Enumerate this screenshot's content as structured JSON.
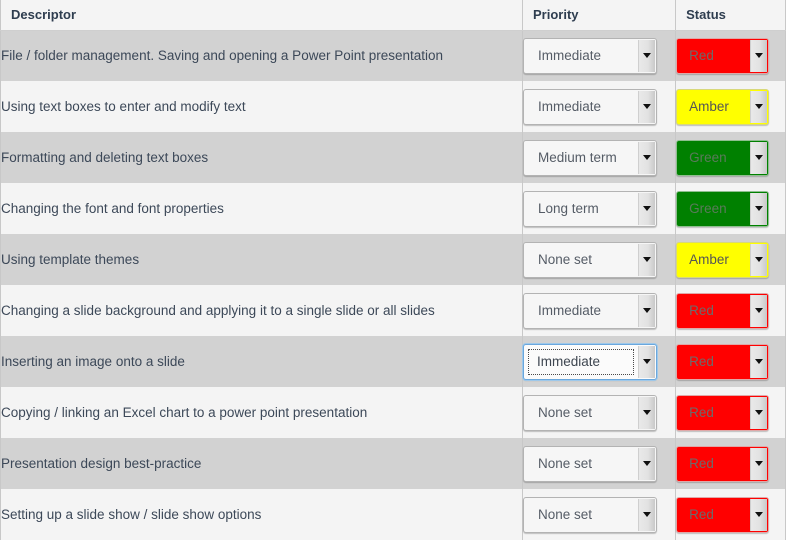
{
  "table": {
    "columns": [
      {
        "key": "descriptor",
        "label": "Descriptor"
      },
      {
        "key": "priority",
        "label": "Priority"
      },
      {
        "key": "status",
        "label": "Status"
      }
    ],
    "rows": [
      {
        "descriptor": "File / folder management. Saving and opening a Power Point presentation",
        "priority": "Immediate",
        "status": "Red",
        "status_color": "#ff0000",
        "stripe": "even",
        "focused": false
      },
      {
        "descriptor": "Using text boxes to enter and modify text",
        "priority": "Immediate",
        "status": "Amber",
        "status_color": "#ffff00",
        "stripe": "odd",
        "focused": false
      },
      {
        "descriptor": "Formatting and deleting text boxes",
        "priority": "Medium term",
        "status": "Green",
        "status_color": "#008000",
        "stripe": "even",
        "focused": false
      },
      {
        "descriptor": "Changing the font and font properties",
        "priority": "Long term",
        "status": "Green",
        "status_color": "#008000",
        "stripe": "odd",
        "focused": false
      },
      {
        "descriptor": "Using template themes",
        "priority": "None set",
        "status": "Amber",
        "status_color": "#ffff00",
        "stripe": "even",
        "focused": false
      },
      {
        "descriptor": "Changing a slide background and applying it to a single slide or all slides",
        "priority": "Immediate",
        "status": "Red",
        "status_color": "#ff0000",
        "stripe": "odd",
        "focused": false
      },
      {
        "descriptor": "Inserting an image onto a slide",
        "priority": "Immediate",
        "status": "Red",
        "status_color": "#ff0000",
        "stripe": "even",
        "focused": true
      },
      {
        "descriptor": "Copying / linking an Excel chart to a power point presentation",
        "priority": "None set",
        "status": "Red",
        "status_color": "#ff0000",
        "stripe": "odd",
        "focused": false
      },
      {
        "descriptor": "Presentation design best-practice",
        "priority": "None set",
        "status": "Red",
        "status_color": "#ff0000",
        "stripe": "even",
        "focused": false
      },
      {
        "descriptor": "Setting up a slide show / slide show options",
        "priority": "None set",
        "status": "Red",
        "status_color": "#ff0000",
        "stripe": "odd",
        "focused": false
      }
    ],
    "priority_options": [
      "None set",
      "Immediate",
      "Medium term",
      "Long term"
    ],
    "status_options": [
      "Red",
      "Amber",
      "Green"
    ],
    "icons": {
      "dropdown": "chevron-down-icon"
    }
  }
}
